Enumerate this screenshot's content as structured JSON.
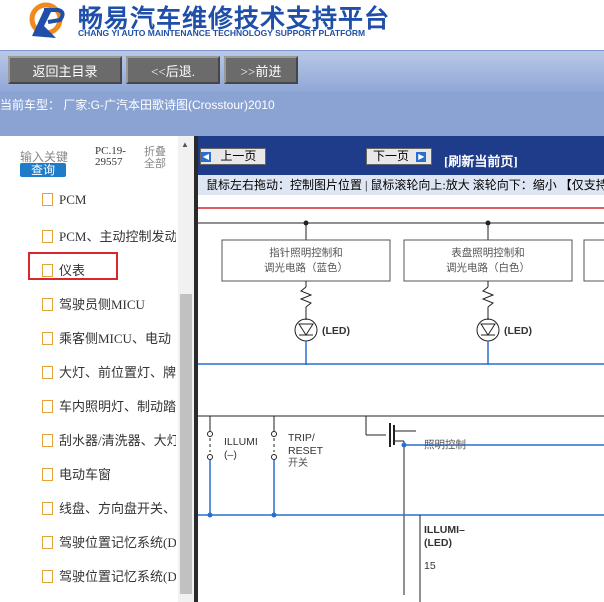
{
  "header": {
    "title_cn": "畅易汽车维修技术支持平台",
    "title_en": "CHANG YI AUTO MAINTENANCE TECHNOLOGY SUPPORT PLATFORM"
  },
  "nav": {
    "home": "返回主目录",
    "back": "<<后退.",
    "forward": ">>前进"
  },
  "car_model": "当前车型： 厂家:G-广汽本田歌诗图(Crosstour)2010",
  "left": {
    "keyword_label": "输入关键",
    "search_button": "查询",
    "pc_code": "PC.19-29557",
    "fold": "折叠全部",
    "items": [
      "PCM",
      "PCM、主动控制发动",
      "仪表",
      "驾驶员侧MICU",
      "乘客侧MICU、电动",
      "大灯、前位置灯、牌",
      "车内照明灯、制动踏",
      "刮水器/清洗器、大灯",
      "电动车窗",
      "线盘、方向盘开关、",
      "驾驶位置记忆系统(D",
      "驾驶位置记忆系统(D"
    ],
    "selected_index": 2
  },
  "viewer": {
    "prev_page": "上一页",
    "next_page": "下一页",
    "refresh": "[刷新当前页]",
    "hint": "鼠标左右拖动：控制图片位置 | 鼠标滚轮向上:放大  滚轮向下：缩小 【仅支持"
  },
  "diagram": {
    "box1_line1": "指针照明控制和",
    "box1_line2": "调光电路（蓝色）",
    "box2_line1": "表盘照明控制和",
    "box2_line2": "调光电路（白色）",
    "led1": "(LED)",
    "led2": "(LED)",
    "illumi": "ILLUMI",
    "illumi_neg": "(–)",
    "trip": "TRIP/",
    "reset": "RESET",
    "switch_cn": "开关",
    "lighting_ctrl": "照明控制",
    "illumi_led_1": "ILLUMI–",
    "illumi_led_2": "(LED)",
    "pin": "15"
  },
  "colors": {
    "brand_blue": "#1f4fa8",
    "toolbar_blue": "#1f3c8a",
    "wire_blue": "#2a6fd0",
    "wire_red": "#d9272e",
    "highlight_red": "#d9272e"
  }
}
